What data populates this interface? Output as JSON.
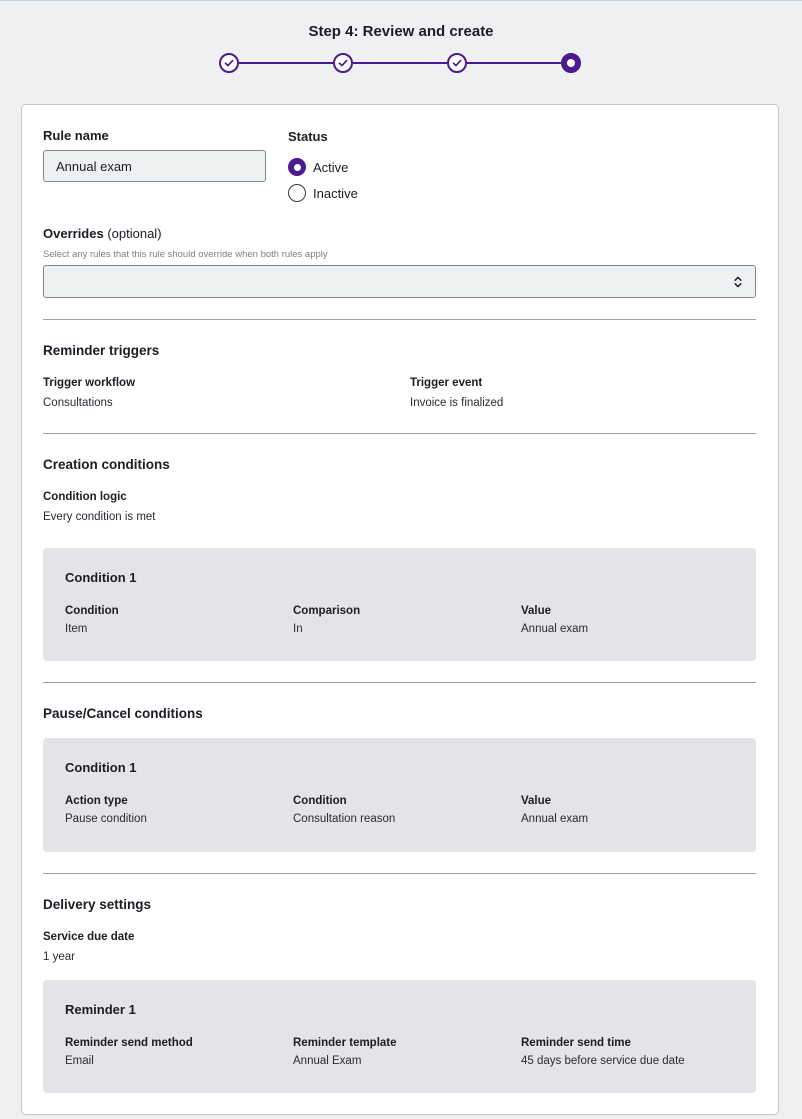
{
  "header": {
    "step_title": "Step 4: Review and create",
    "steps": [
      {
        "state": "complete",
        "icon": "check-icon"
      },
      {
        "state": "complete",
        "icon": "check-icon"
      },
      {
        "state": "complete",
        "icon": "check-icon"
      },
      {
        "state": "current",
        "icon": "dot-icon"
      }
    ],
    "accent_color": "#4b1a8f"
  },
  "rule": {
    "name_label": "Rule name",
    "name_value": "Annual exam",
    "status_label": "Status",
    "status_options": [
      {
        "label": "Active",
        "selected": true
      },
      {
        "label": "Inactive",
        "selected": false
      }
    ]
  },
  "overrides": {
    "label": "Overrides",
    "optional": "(optional)",
    "hint": "Select any rules that this rule should override when both rules apply",
    "value": ""
  },
  "reminder_triggers": {
    "title": "Reminder triggers",
    "workflow_label": "Trigger workflow",
    "workflow_value": "Consultations",
    "event_label": "Trigger event",
    "event_value": "Invoice is finalized"
  },
  "creation_conditions": {
    "title": "Creation conditions",
    "logic_label": "Condition logic",
    "logic_value": "Every condition is met",
    "condition": {
      "title": "Condition 1",
      "columns": [
        {
          "label": "Condition",
          "value": "Item"
        },
        {
          "label": "Comparison",
          "value": "In"
        },
        {
          "label": "Value",
          "value": "Annual exam"
        }
      ]
    }
  },
  "pause_cancel_conditions": {
    "title": "Pause/Cancel conditions",
    "condition": {
      "title": "Condition 1",
      "columns": [
        {
          "label": "Action type",
          "value": "Pause condition"
        },
        {
          "label": "Condition",
          "value": "Consultation reason"
        },
        {
          "label": "Value",
          "value": "Annual exam"
        }
      ]
    }
  },
  "delivery_settings": {
    "title": "Delivery settings",
    "due_date_label": "Service due date",
    "due_date_value": "1 year",
    "reminder": {
      "title": "Reminder 1",
      "columns": [
        {
          "label": "Reminder send method",
          "value": "Email"
        },
        {
          "label": "Reminder template",
          "value": "Annual Exam"
        },
        {
          "label": "Reminder send time",
          "value": "45 days before service due date"
        }
      ]
    }
  }
}
